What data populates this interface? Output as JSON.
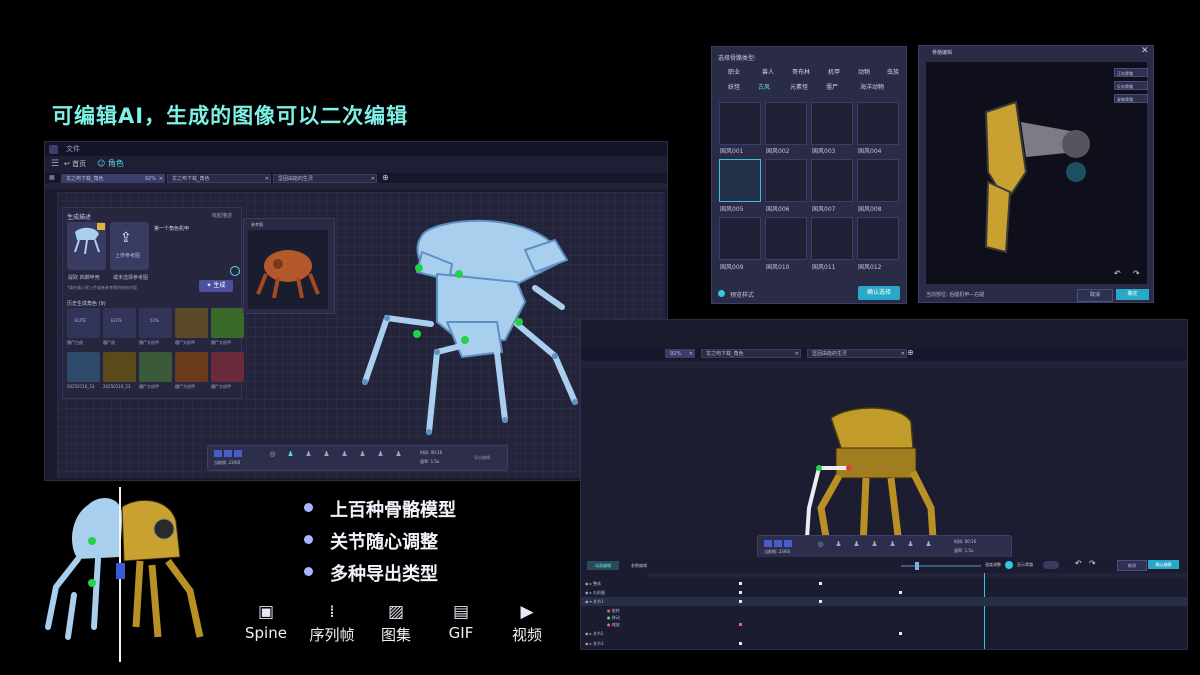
{
  "headline": "可编辑AI，生成的图像可以二次编辑",
  "main_window": {
    "menu_file": "文件",
    "back_label": "首页",
    "role_label": "角色",
    "tabs": [
      {
        "label": "龙之吻下载_角色",
        "progress": "92%"
      },
      {
        "label": "龙之吻下载_角色",
        "progress": ""
      },
      {
        "label": "坚固由能的生灵",
        "progress": ""
      }
    ],
    "gen_panel": {
      "title": "生成描述",
      "collapse": "收起描述",
      "slot1_label": "提取 四脚甲壳",
      "slot2_label": "上传参考图",
      "slot2_sub": "或未选择参考图",
      "prompt_title": "第一个角色机甲",
      "hint": "*请在输入框上传或者参考图的结构内容",
      "generate_button": "生成",
      "history_title": "历史生成角色 (9)",
      "history": [
        {
          "top": "ELITE",
          "label": "僵尸白虎"
        },
        {
          "top": "ELITE",
          "label": "僵尸虎"
        },
        {
          "top": "52%",
          "label": "僵尸大机甲"
        },
        {
          "top": "",
          "label": "僵尸大机甲"
        },
        {
          "top": "",
          "label": "僵尸大机甲"
        },
        {
          "top": "",
          "label": "20250116_53"
        },
        {
          "top": "",
          "label": "20250116_53"
        },
        {
          "top": "",
          "label": "僵尸大机甲"
        },
        {
          "top": "",
          "label": "僵尸大机甲"
        },
        {
          "top": "",
          "label": "僵尸大机甲"
        }
      ]
    },
    "ref_panel_label": "参考图",
    "playbar": {
      "frame": "当前帧: 23/60",
      "time": "时间: 00:16",
      "speed": "速率: 1.5x",
      "export": "导出编辑"
    }
  },
  "bones_dialog": {
    "title": "选择骨骼类型:",
    "categories": [
      "职业",
      "兽人",
      "哥布林",
      "机甲",
      "动物",
      "虫族",
      "妖怪",
      "古风",
      "元素怪",
      "僵尸",
      "海洋动物"
    ],
    "selected_category": "古风",
    "items": [
      "国风001",
      "国风002",
      "国风003",
      "国风004",
      "国风005",
      "国风006",
      "国风007",
      "国风008",
      "国风009",
      "国风010",
      "国风011",
      "国风012"
    ],
    "selected_item": "国风005",
    "preset_label": "预览样式",
    "confirm_button": "确认选择"
  },
  "preview_dialog": {
    "title": "骨骼编辑",
    "options": [
      "正向骨骼",
      "反向骨骼",
      "复制骨骼"
    ],
    "info": "当前部位: 后腿机甲—右腿",
    "cancel": "取消",
    "ok": "确定"
  },
  "editor2": {
    "tabs": [
      {
        "label": "",
        "progress": "92%"
      },
      {
        "label": "龙之吻下载_角色",
        "progress": ""
      },
      {
        "label": "坚固由能的生灵",
        "progress": ""
      }
    ],
    "playbar": {
      "frame": "当前帧: 23/60",
      "time": "时间: 00:16",
      "speed": "速率: 1.5x"
    },
    "timeline": {
      "tab_anim": "动画编辑",
      "tab_param": "参数编辑",
      "speed_label": "速度调整",
      "loop_label": "显示骨骼",
      "cancel": "取消",
      "confirm": "确认编辑",
      "rows": [
        "整体",
        "右前腿",
        "关节1",
        "旋转",
        "移动",
        "缩放",
        "关节2",
        "关节3"
      ]
    }
  },
  "features": [
    "上百种骨骼模型",
    "关节随心调整",
    "多种导出类型"
  ],
  "exports": [
    {
      "icon": "film-icon",
      "label": "Spine"
    },
    {
      "icon": "mic-icon",
      "label": "序列帧"
    },
    {
      "icon": "image-icon",
      "label": "图集"
    },
    {
      "icon": "gif-icon",
      "label": "GIF"
    },
    {
      "icon": "video-icon",
      "label": "视频"
    }
  ],
  "colors": {
    "accent": "#2aa8c8",
    "headline": "#7ff0e6",
    "skeleton": "#a9cfee",
    "joint": "#22d34a",
    "mech": "#d4a52a"
  }
}
